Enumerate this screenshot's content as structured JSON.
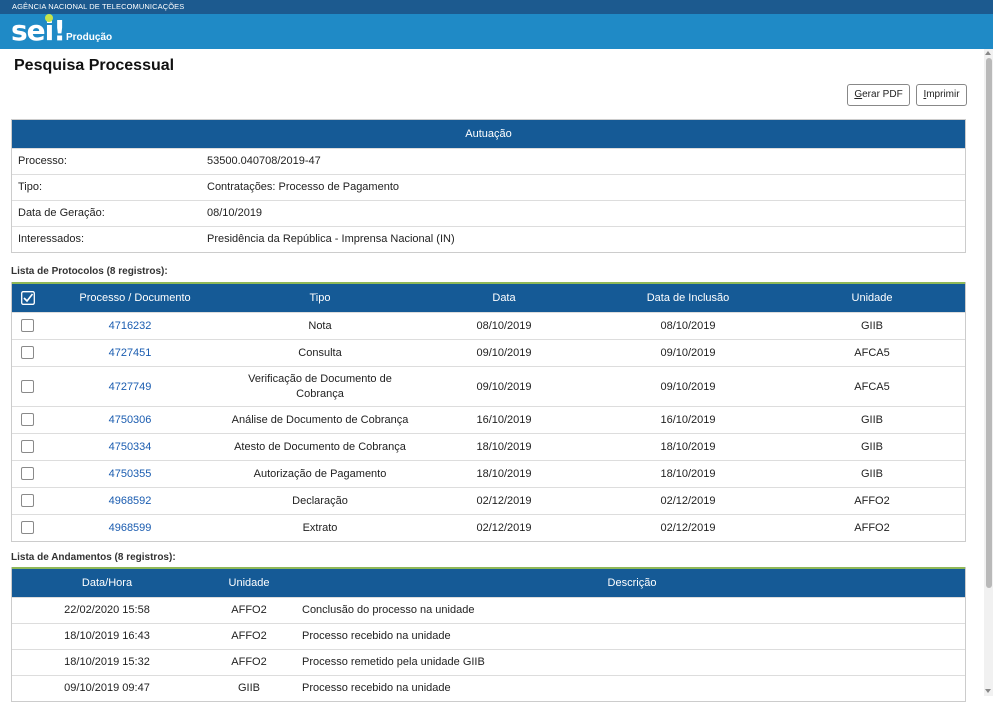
{
  "agency": "AGÊNCIA NACIONAL DE TELECOMUNICAÇÕES",
  "logo_text": "sei",
  "environment": "Produção",
  "page_title": "Pesquisa Processual",
  "buttons": {
    "pdf_prefix": "G",
    "pdf_rest": "erar PDF",
    "print_prefix": "I",
    "print_rest": "mprimir"
  },
  "autuacao": {
    "header": "Autuação",
    "rows": [
      {
        "label": "Processo:",
        "value": "53500.040708/2019-47"
      },
      {
        "label": "Tipo:",
        "value": "Contratações: Processo de Pagamento"
      },
      {
        "label": "Data de Geração:",
        "value": "08/10/2019"
      },
      {
        "label": "Interessados:",
        "value": "Presidência da República - Imprensa Nacional (IN)"
      }
    ]
  },
  "protocolos": {
    "title": "Lista de Protocolos (8 registros):",
    "columns": [
      "Processo / Documento",
      "Tipo",
      "Data",
      "Data de Inclusão",
      "Unidade"
    ],
    "rows": [
      {
        "doc": "4716232",
        "tipo": "Nota",
        "data": "08/10/2019",
        "inclusao": "08/10/2019",
        "unidade": "GIIB"
      },
      {
        "doc": "4727451",
        "tipo": "Consulta",
        "data": "09/10/2019",
        "inclusao": "09/10/2019",
        "unidade": "AFCA5"
      },
      {
        "doc": "4727749",
        "tipo": "Verificação de Documento de Cobrança",
        "data": "09/10/2019",
        "inclusao": "09/10/2019",
        "unidade": "AFCA5"
      },
      {
        "doc": "4750306",
        "tipo": "Análise de Documento de Cobrança",
        "data": "16/10/2019",
        "inclusao": "16/10/2019",
        "unidade": "GIIB"
      },
      {
        "doc": "4750334",
        "tipo": "Atesto de Documento de Cobrança",
        "data": "18/10/2019",
        "inclusao": "18/10/2019",
        "unidade": "GIIB"
      },
      {
        "doc": "4750355",
        "tipo": "Autorização de Pagamento",
        "data": "18/10/2019",
        "inclusao": "18/10/2019",
        "unidade": "GIIB"
      },
      {
        "doc": "4968592",
        "tipo": "Declaração",
        "data": "02/12/2019",
        "inclusao": "02/12/2019",
        "unidade": "AFFO2"
      },
      {
        "doc": "4968599",
        "tipo": "Extrato",
        "data": "02/12/2019",
        "inclusao": "02/12/2019",
        "unidade": "AFFO2"
      }
    ]
  },
  "andamentos": {
    "title": "Lista de Andamentos (8 registros):",
    "columns": [
      "Data/Hora",
      "Unidade",
      "Descrição"
    ],
    "rows": [
      {
        "datahora": "22/02/2020 15:58",
        "unidade": "AFFO2",
        "descricao": "Conclusão do processo na unidade"
      },
      {
        "datahora": "18/10/2019 16:43",
        "unidade": "AFFO2",
        "descricao": "Processo recebido na unidade"
      },
      {
        "datahora": "18/10/2019 15:32",
        "unidade": "AFFO2",
        "descricao": "Processo remetido pela unidade GIIB"
      },
      {
        "datahora": "09/10/2019 09:47",
        "unidade": "GIIB",
        "descricao": "Processo recebido na unidade"
      }
    ]
  }
}
